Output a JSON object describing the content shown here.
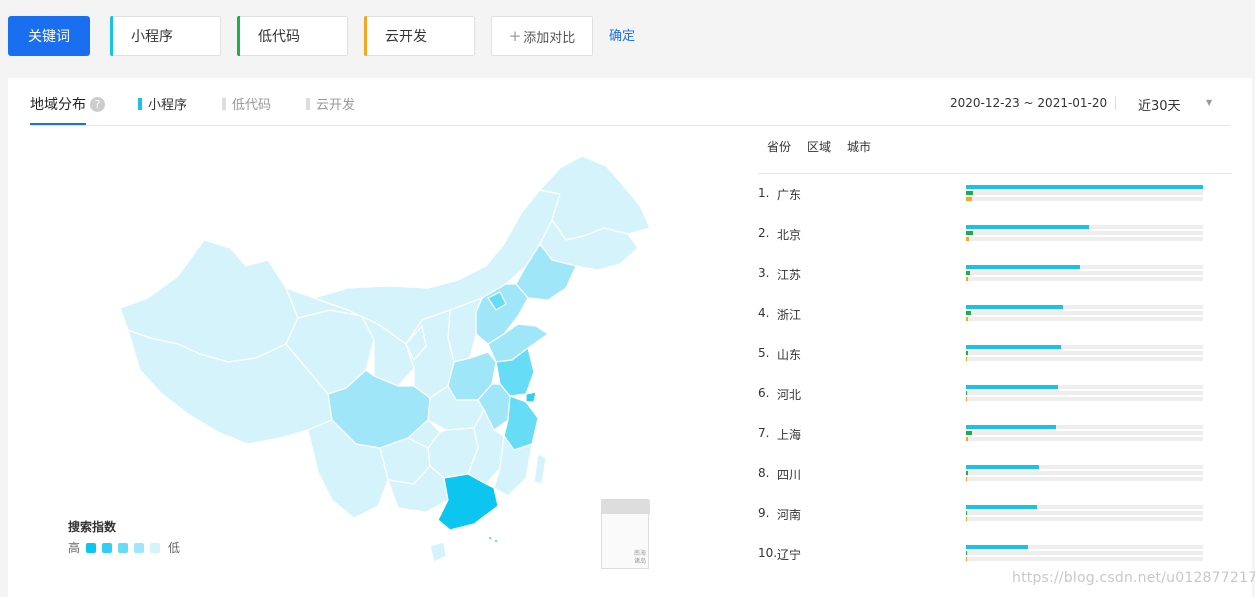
{
  "toolbar": {
    "keyword_button": "关键词",
    "terms": [
      {
        "label": "小程序",
        "color": "#19c3e6"
      },
      {
        "label": "低代码",
        "color": "#1ab04a"
      },
      {
        "label": "云开发",
        "color": "#f5a623"
      }
    ],
    "add_label": "添加对比",
    "confirm_label": "确定"
  },
  "panel": {
    "tab_label": "地域分布",
    "help_glyph": "?",
    "legend_terms": [
      {
        "label": "小程序",
        "active": true
      },
      {
        "label": "低代码",
        "active": false
      },
      {
        "label": "云开发",
        "active": false
      }
    ],
    "date_range": "2020-12-23 ~ 2021-01-20",
    "period": "近30天"
  },
  "map": {
    "legend_title": "搜索指数",
    "legend_high": "高",
    "legend_low": "低",
    "legend_colors": [
      "#0dc6f0",
      "#2fd0f3",
      "#66dcf5",
      "#9fe7f8",
      "#d4f3fb"
    ],
    "inset_label": "南海诸岛"
  },
  "ranking": {
    "tabs": [
      "省份",
      "区域",
      "城市"
    ],
    "rows": [
      {
        "rank": "1.",
        "name": "广东",
        "mini": 1.0,
        "lowcode": 0.03,
        "cloud": 0.025
      },
      {
        "rank": "2.",
        "name": "北京",
        "mini": 0.52,
        "lowcode": 0.03,
        "cloud": 0.012
      },
      {
        "rank": "3.",
        "name": "江苏",
        "mini": 0.48,
        "lowcode": 0.015,
        "cloud": 0.01
      },
      {
        "rank": "4.",
        "name": "浙江",
        "mini": 0.41,
        "lowcode": 0.02,
        "cloud": 0.01
      },
      {
        "rank": "5.",
        "name": "山东",
        "mini": 0.4,
        "lowcode": 0.01,
        "cloud": 0.006
      },
      {
        "rank": "6.",
        "name": "河北",
        "mini": 0.39,
        "lowcode": 0.004,
        "cloud": 0.004
      },
      {
        "rank": "7.",
        "name": "上海",
        "mini": 0.38,
        "lowcode": 0.025,
        "cloud": 0.01
      },
      {
        "rank": "8.",
        "name": "四川",
        "mini": 0.31,
        "lowcode": 0.01,
        "cloud": 0.005
      },
      {
        "rank": "9.",
        "name": "河南",
        "mini": 0.3,
        "lowcode": 0.004,
        "cloud": 0.005
      },
      {
        "rank": "10.",
        "name": "辽宁",
        "mini": 0.26,
        "lowcode": 0.004,
        "cloud": 0.004
      }
    ]
  },
  "watermark": "https://blog.csdn.net/u012877217"
}
